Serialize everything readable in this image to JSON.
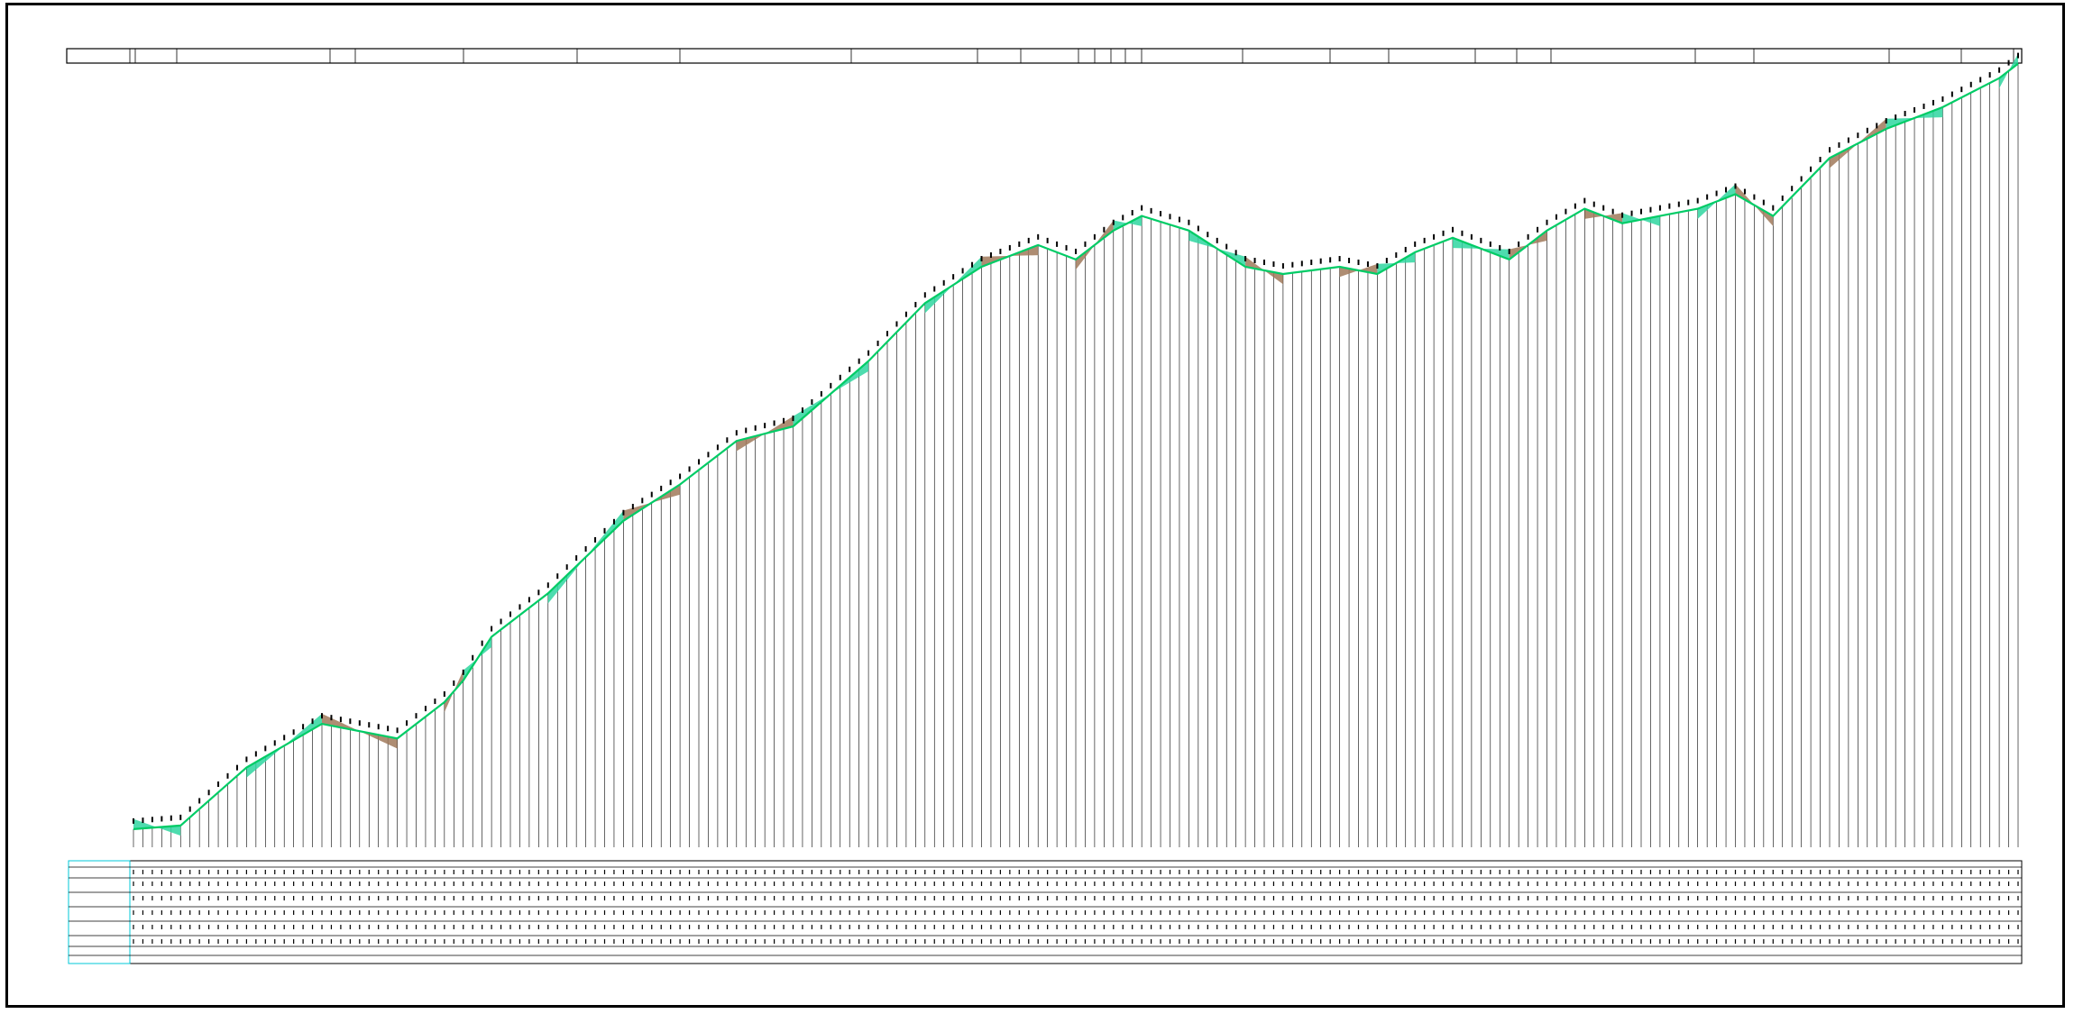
{
  "drawing": {
    "title_text": "",
    "row_labels": [
      "",
      "",
      "",
      "",
      "",
      "",
      "",
      ""
    ],
    "legend_label": ""
  },
  "colors": {
    "frame": "#000000",
    "profile_line": "#00cc66",
    "fill_cut": "#2fd6a0",
    "fill_fill": "#a0795a",
    "axis_labels": "#00c8d8"
  },
  "chart_data": {
    "type": "line",
    "title": "",
    "xlabel": "",
    "ylabel": "",
    "grid": false,
    "x_range": [
      0,
      1000
    ],
    "ylim": [
      0,
      100
    ],
    "series": [
      {
        "x": [
          0,
          25,
          60,
          100,
          140,
          165,
          175,
          190,
          220,
          260,
          290,
          320,
          350,
          390,
          420,
          450,
          480,
          500,
          520,
          535,
          560,
          590,
          610,
          640,
          660,
          680,
          700,
          730,
          750,
          770,
          790,
          810,
          830,
          850,
          870,
          900,
          930,
          960,
          990,
          1000
        ],
        "y": [
          2.5,
          3,
          11,
          17,
          15,
          20,
          23,
          29,
          35,
          45,
          50,
          56,
          58,
          67,
          75,
          80,
          83,
          81,
          85,
          87,
          85,
          80,
          79,
          80,
          79,
          82,
          84,
          81,
          85,
          88,
          86,
          87,
          88,
          90,
          87,
          95,
          99,
          102,
          106,
          108
        ]
      }
    ]
  }
}
